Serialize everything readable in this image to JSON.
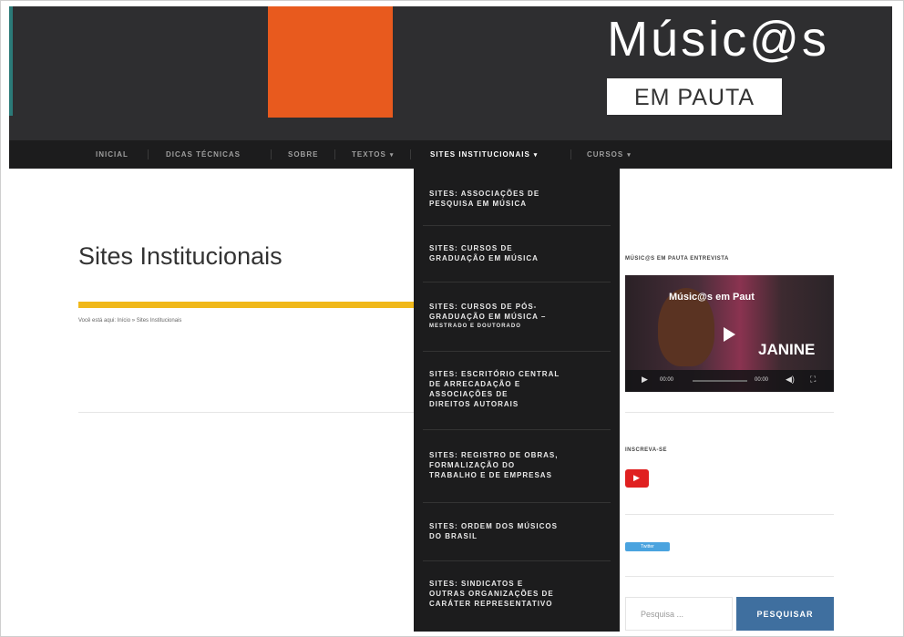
{
  "header": {
    "logo_title": "Músic@s",
    "logo_subtitle": "EM PAUTA",
    "colors": {
      "bg": "#2e2e30",
      "accent_orange": "#e85a1e",
      "accent_teal": "#2b7a78"
    }
  },
  "nav": {
    "items": [
      {
        "label": "INICIAL"
      },
      {
        "label": "DICAS TÉCNICAS"
      },
      {
        "label": "SOBRE"
      },
      {
        "label": "TEXTOS",
        "has_caret": true
      },
      {
        "label": "SITES INSTITUCIONAIS",
        "has_caret": true,
        "active": true
      },
      {
        "label": "CURSOS",
        "has_caret": true
      }
    ]
  },
  "dropdown": {
    "items": [
      {
        "line1": "SITES: ASSOCIAÇÕES DE",
        "line2": "PESQUISA EM MÚSICA",
        "line3": "",
        "line4": ""
      },
      {
        "line1": "SITES: CURSOS DE",
        "line2": "GRADUAÇÃO EM MÚSICA",
        "line3": "",
        "line4": ""
      },
      {
        "line1": "SITES: CURSOS DE PÓS-",
        "line2": "GRADUAÇÃO EM MÚSICA –",
        "line3": "MESTRADO E DOUTORADO",
        "line4": ""
      },
      {
        "line1": "SITES: ESCRITÓRIO CENTRAL",
        "line2": "DE ARRECADAÇÃO E",
        "line3": "ASSOCIAÇÕES DE",
        "line4": "DIREITOS AUTORAIS"
      },
      {
        "line1": "SITES: REGISTRO DE OBRAS,",
        "line2": "FORMALIZAÇÃO DO",
        "line3": "TRABALHO E DE EMPRESAS",
        "line4": ""
      },
      {
        "line1": "SITES: ORDEM DOS MÚSICOS",
        "line2": "DO BRASIL",
        "line3": "",
        "line4": ""
      },
      {
        "line1": "SITES: SINDICATOS E",
        "line2": "OUTRAS ORGANIZAÇÕES DE",
        "line3": "CARÁTER REPRESENTATIVO",
        "line4": ""
      }
    ]
  },
  "main": {
    "page_title": "Sites Institucionais",
    "breadcrumb": "Você está aqui: Início » Sites Institucionais",
    "accent_bar_color": "#f0b81a"
  },
  "sidebar": {
    "video_widget_title": "MÚSIC@S EM PAUTA ENTREVISTA",
    "video": {
      "title": "Músic@s em Paut",
      "name": "JANINE",
      "time_current": "00:00",
      "time_total": "00:00"
    },
    "social_widget_title": "INSCREVA-SE",
    "twitter_label": "Twitter",
    "search": {
      "placeholder": "Pesquisa ...",
      "button_label": "PESQUISAR"
    }
  }
}
